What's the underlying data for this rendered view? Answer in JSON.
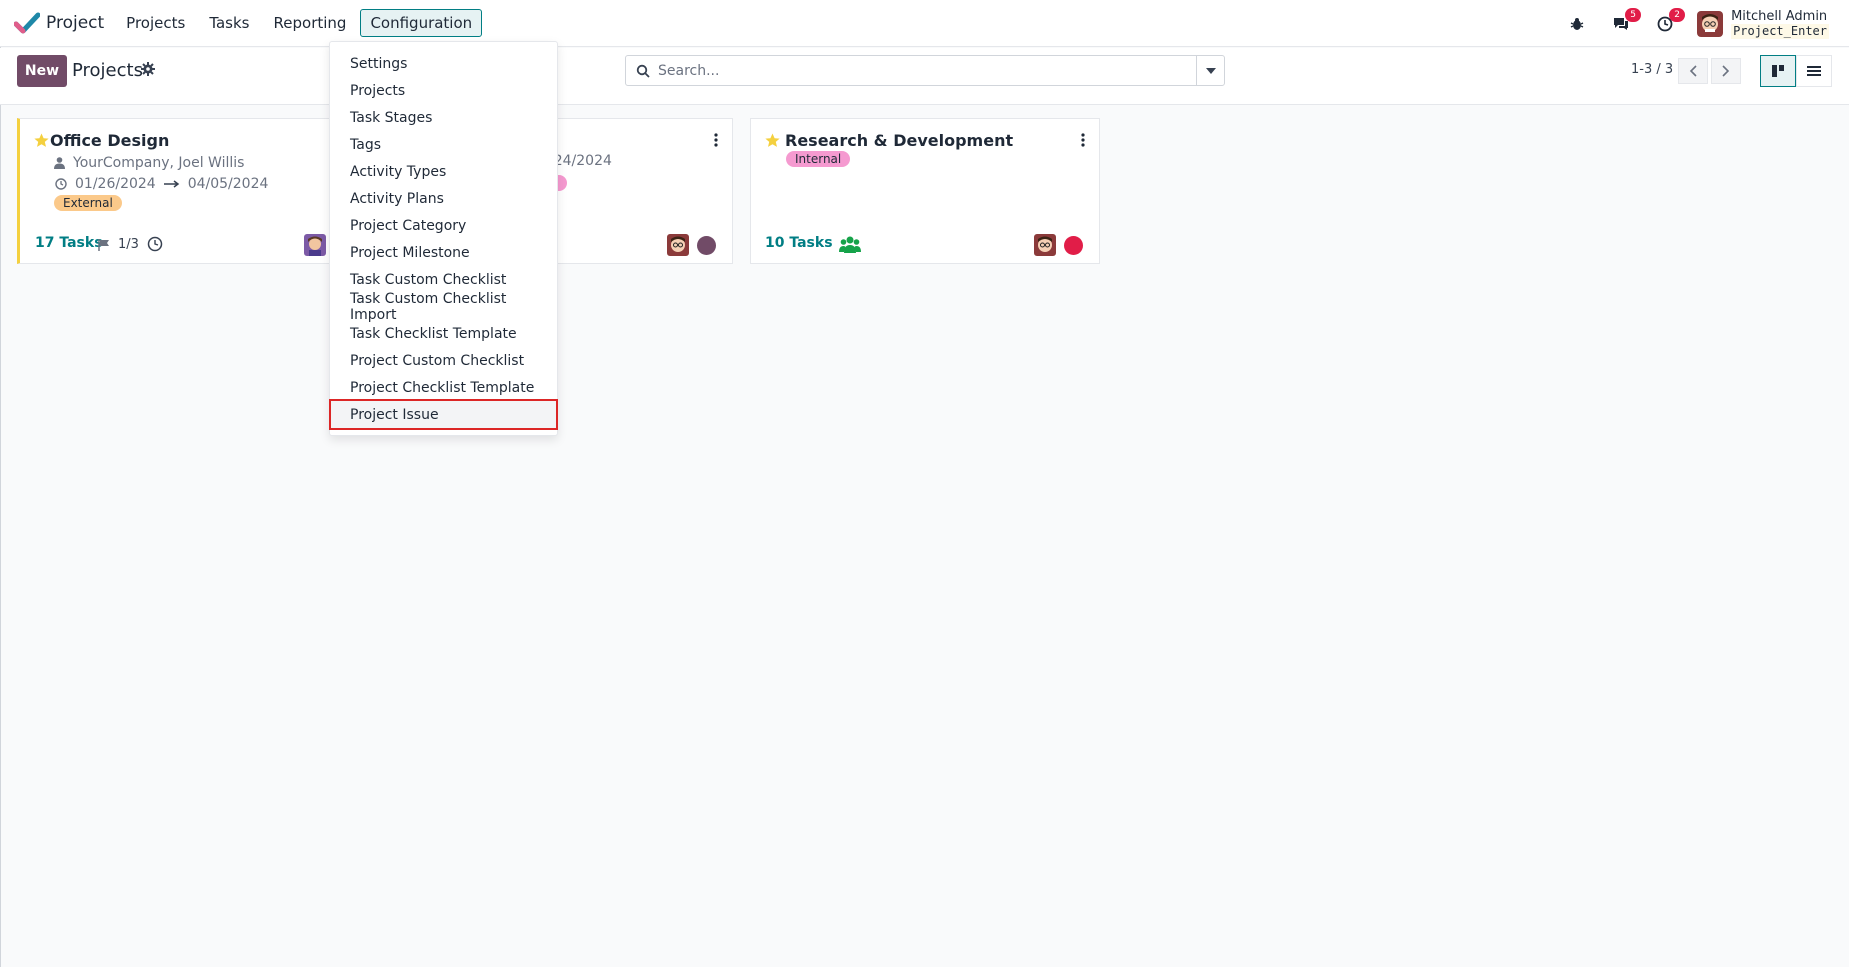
{
  "navbar": {
    "app_name": "Project",
    "menu": [
      {
        "label": "Projects"
      },
      {
        "label": "Tasks"
      },
      {
        "label": "Reporting"
      },
      {
        "label": "Configuration"
      }
    ],
    "messages_badge": "5",
    "activities_badge": "2",
    "user_name": "Mitchell Admin",
    "database": "Project_Enter"
  },
  "control_panel": {
    "new_label": "New",
    "title": "Projects",
    "search_placeholder": "Search...",
    "pager": "1-3 / 3"
  },
  "dropdown": {
    "items": [
      {
        "label": "Settings"
      },
      {
        "label": "Projects"
      },
      {
        "label": "Task Stages"
      },
      {
        "label": "Tags"
      },
      {
        "label": "Activity Types"
      },
      {
        "label": "Activity Plans"
      },
      {
        "label": "Project Category"
      },
      {
        "label": "Project Milestone"
      },
      {
        "label": "Task Custom Checklist"
      },
      {
        "label": "Task Custom Checklist Import"
      },
      {
        "label": "Task Checklist Template"
      },
      {
        "label": "Project Custom Checklist"
      },
      {
        "label": "Project Checklist Template"
      },
      {
        "label": "Project Issue"
      }
    ],
    "highlighted_index": 13
  },
  "cards": [
    {
      "name": "Office Design",
      "customer": "YourCompany, Joel Willis",
      "date_start": "01/26/2024",
      "date_end": "04/05/2024",
      "tag": "External",
      "tag_color": "#fbc98a",
      "tasks": "17 Tasks",
      "milestones": "1/3"
    },
    {
      "date_end_partial": "/24/2024"
    },
    {
      "name": "Research & Development",
      "tag": "Internal",
      "tag_color": "#f59ad0",
      "tasks": "10 Tasks",
      "status_color": "#e11d48"
    }
  ],
  "colors": {
    "brand": "#714b67",
    "accent": "#017e84",
    "favorite": "#f4d03f"
  }
}
